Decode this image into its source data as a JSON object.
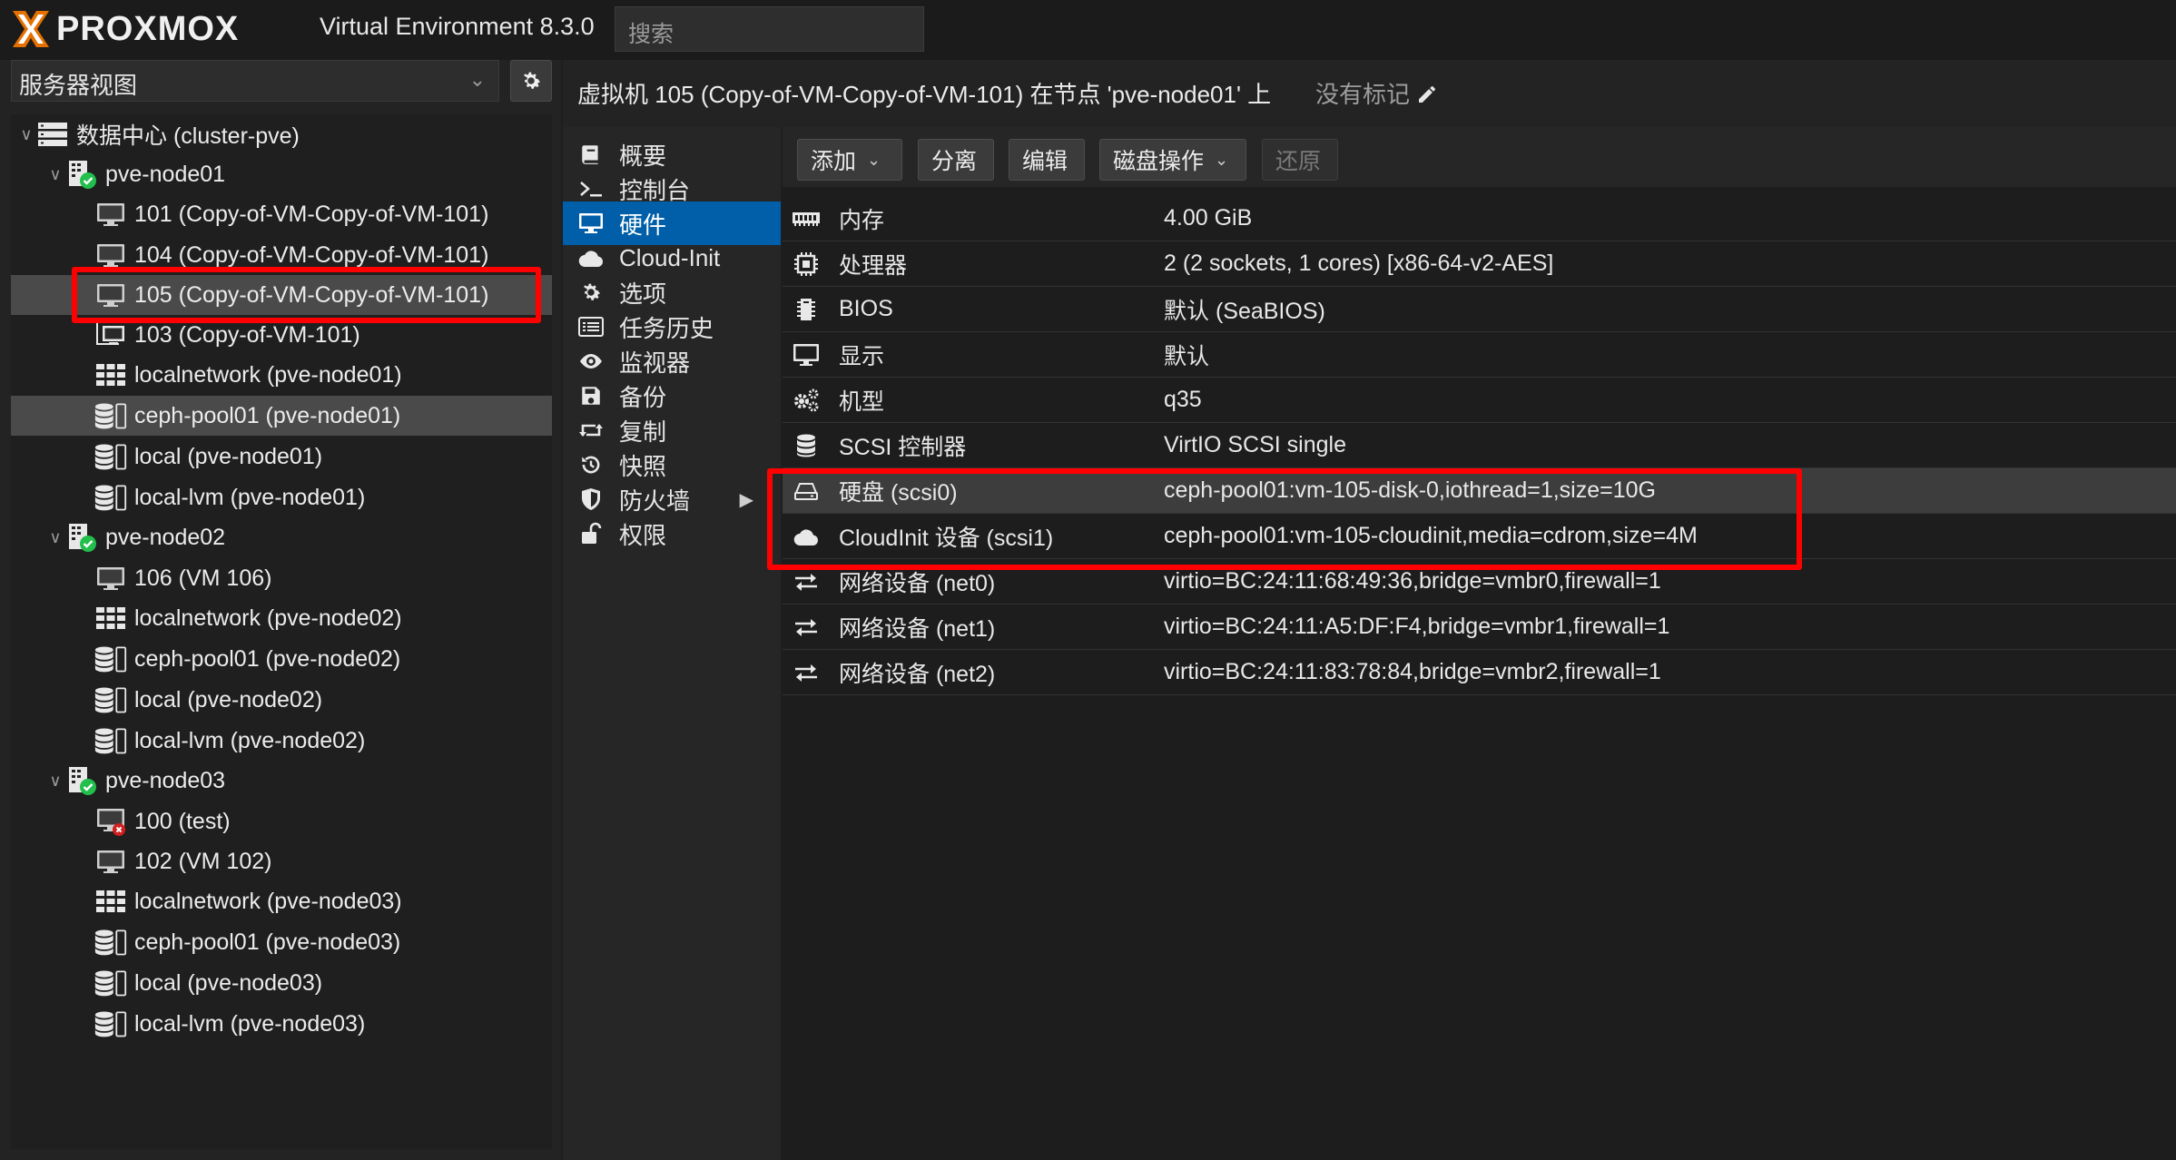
{
  "app": {
    "brand": "PROXMOX",
    "version": "Virtual Environment 8.3.0",
    "search_placeholder": "搜索"
  },
  "left_panel": {
    "view": "服务器视图",
    "tree": [
      {
        "label": "数据中心 (cluster-pve)",
        "icon": "datacenter-icon",
        "level": 0
      },
      {
        "label": "pve-node01",
        "icon": "node-online-icon",
        "level": 1
      },
      {
        "label": "101 (Copy-of-VM-Copy-of-VM-101)",
        "icon": "vm-icon",
        "level": 2
      },
      {
        "label": "104 (Copy-of-VM-Copy-of-VM-101)",
        "icon": "vm-icon",
        "level": 2
      },
      {
        "label": "105 (Copy-of-VM-Copy-of-VM-101)",
        "icon": "vm-icon",
        "level": 2,
        "selected": true
      },
      {
        "label": "103 (Copy-of-VM-101)",
        "icon": "template-icon",
        "level": 2
      },
      {
        "label": "localnetwork (pve-node01)",
        "icon": "network-icon",
        "level": 2
      },
      {
        "label": "ceph-pool01 (pve-node01)",
        "icon": "storage-icon",
        "level": 2,
        "highlight": true
      },
      {
        "label": "local (pve-node01)",
        "icon": "storage-icon",
        "level": 2
      },
      {
        "label": "local-lvm (pve-node01)",
        "icon": "storage-icon",
        "level": 2
      },
      {
        "label": "pve-node02",
        "icon": "node-online-icon",
        "level": 1
      },
      {
        "label": "106 (VM 106)",
        "icon": "vm-icon",
        "level": 2
      },
      {
        "label": "localnetwork (pve-node02)",
        "icon": "network-icon",
        "level": 2
      },
      {
        "label": "ceph-pool01 (pve-node02)",
        "icon": "storage-icon",
        "level": 2
      },
      {
        "label": "local (pve-node02)",
        "icon": "storage-icon",
        "level": 2
      },
      {
        "label": "local-lvm (pve-node02)",
        "icon": "storage-icon",
        "level": 2
      },
      {
        "label": "pve-node03",
        "icon": "node-online-icon",
        "level": 1
      },
      {
        "label": "100 (test)",
        "icon": "vm-error-icon",
        "level": 2
      },
      {
        "label": "102 (VM 102)",
        "icon": "vm-icon",
        "level": 2
      },
      {
        "label": "localnetwork (pve-node03)",
        "icon": "network-icon",
        "level": 2
      },
      {
        "label": "ceph-pool01 (pve-node03)",
        "icon": "storage-icon",
        "level": 2
      },
      {
        "label": "local (pve-node03)",
        "icon": "storage-icon",
        "level": 2
      },
      {
        "label": "local-lvm (pve-node03)",
        "icon": "storage-icon",
        "level": 2
      }
    ]
  },
  "header": {
    "title": "虚拟机 105 (Copy-of-VM-Copy-of-VM-101) 在节点 'pve-node01' 上",
    "tags": "没有标记"
  },
  "nav": {
    "items": [
      {
        "label": "概要",
        "icon": "book-icon"
      },
      {
        "label": "控制台",
        "icon": "terminal-icon"
      },
      {
        "label": "硬件",
        "icon": "monitor-icon",
        "active": true
      },
      {
        "label": "Cloud-Init",
        "icon": "cloud-icon"
      },
      {
        "label": "选项",
        "icon": "gear-icon"
      },
      {
        "label": "任务历史",
        "icon": "list-icon"
      },
      {
        "label": "监视器",
        "icon": "eye-icon"
      },
      {
        "label": "备份",
        "icon": "floppy-icon"
      },
      {
        "label": "复制",
        "icon": "retweet-icon"
      },
      {
        "label": "快照",
        "icon": "history-icon"
      },
      {
        "label": "防火墙",
        "icon": "shield-icon",
        "expand": true
      },
      {
        "label": "权限",
        "icon": "unlock-icon"
      }
    ]
  },
  "toolbar": {
    "add": "添加",
    "detach": "分离",
    "edit": "编辑",
    "disk_action": "磁盘操作",
    "revert": "还原"
  },
  "hardware": [
    {
      "name": "内存",
      "value": "4.00 GiB",
      "icon": "memory-icon"
    },
    {
      "name": "处理器",
      "value": "2 (2 sockets, 1 cores) [x86-64-v2-AES]",
      "icon": "cpu-icon"
    },
    {
      "name": "BIOS",
      "value": "默认 (SeaBIOS)",
      "icon": "bios-icon"
    },
    {
      "name": "显示",
      "value": "默认",
      "icon": "display-icon"
    },
    {
      "name": "机型",
      "value": "q35",
      "icon": "cogs-icon"
    },
    {
      "name": "SCSI 控制器",
      "value": "VirtIO SCSI single",
      "icon": "database-icon"
    },
    {
      "name": "硬盘 (scsi0)",
      "value": "ceph-pool01:vm-105-disk-0,iothread=1,size=10G",
      "icon": "hdd-icon",
      "selected": true
    },
    {
      "name": "CloudInit 设备 (scsi1)",
      "value": "ceph-pool01:vm-105-cloudinit,media=cdrom,size=4M",
      "icon": "cloud-icon"
    },
    {
      "name": "网络设备 (net0)",
      "value": "virtio=BC:24:11:68:49:36,bridge=vmbr0,firewall=1",
      "icon": "exchange-icon"
    },
    {
      "name": "网络设备 (net1)",
      "value": "virtio=BC:24:11:A5:DF:F4,bridge=vmbr1,firewall=1",
      "icon": "exchange-icon"
    },
    {
      "name": "网络设备 (net2)",
      "value": "virtio=BC:24:11:83:78:84,bridge=vmbr2,firewall=1",
      "icon": "exchange-icon"
    }
  ],
  "colors": {
    "accent": "#005fa8",
    "highlight_box": "#ff0000",
    "logo_orange": "#e57000",
    "status_ok": "#21bf4b",
    "status_error": "#d11f1f"
  }
}
